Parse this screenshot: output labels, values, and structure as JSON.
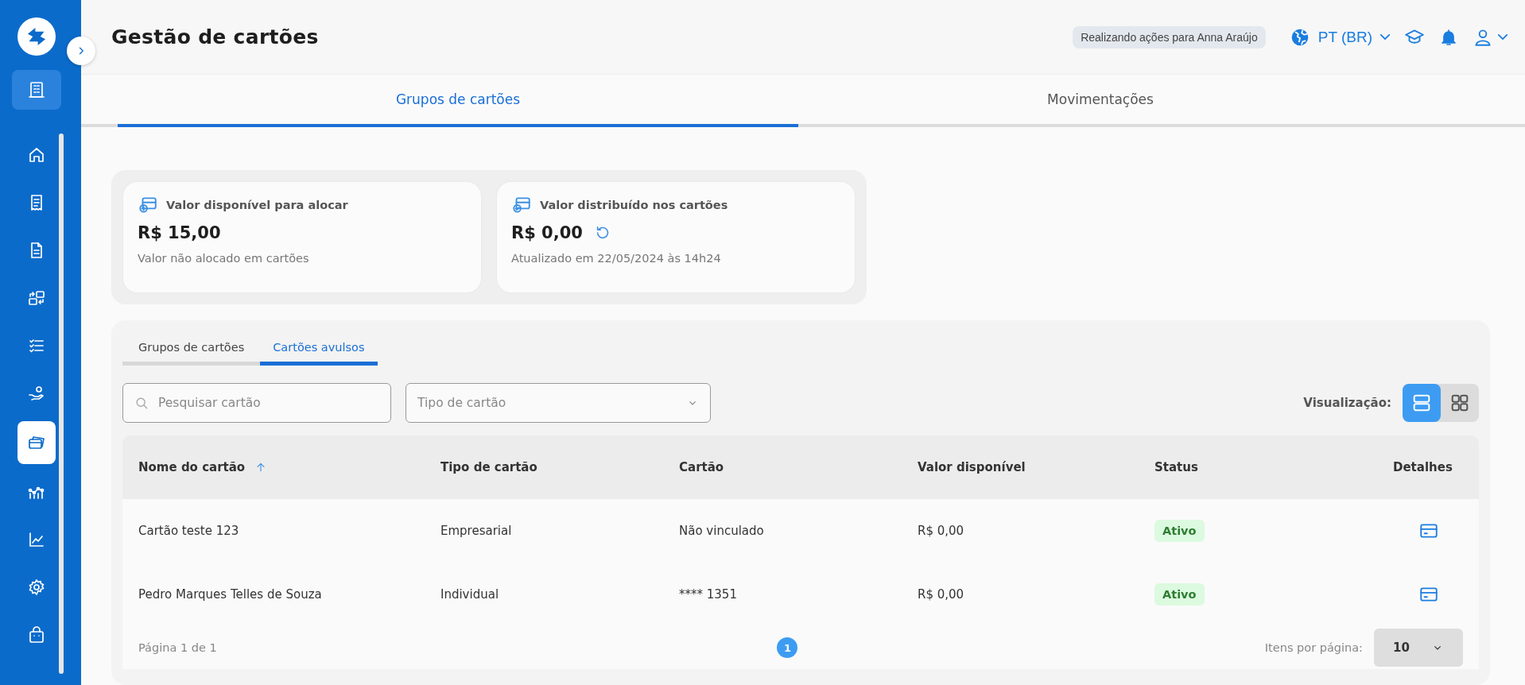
{
  "sidebar": {
    "items": [
      {
        "kind": "building",
        "selected": false
      },
      {
        "kind": "home",
        "selected": false
      },
      {
        "kind": "receipt",
        "selected": false
      },
      {
        "kind": "document",
        "selected": false
      },
      {
        "kind": "transfer",
        "selected": false
      },
      {
        "kind": "checklist",
        "selected": false
      },
      {
        "kind": "hand-coin",
        "selected": false
      },
      {
        "kind": "cards",
        "selected": true
      },
      {
        "kind": "analytics",
        "selected": false
      },
      {
        "kind": "chart",
        "selected": false
      },
      {
        "kind": "gear",
        "selected": false
      },
      {
        "kind": "bag",
        "selected": false
      }
    ]
  },
  "header": {
    "title": "Gestão de cartões",
    "acting_badge": "Realizando ações para Anna Araújo",
    "language": "PT (BR)"
  },
  "tabs": [
    {
      "label": "Grupos de cartões",
      "selected": true
    },
    {
      "label": "Movimentações",
      "selected": false
    }
  ],
  "summary_cards": [
    {
      "kind": "available",
      "title": "Valor disponível para alocar",
      "value": "R$ 15,00",
      "note": "Valor não alocado em cartões",
      "refresh": false
    },
    {
      "kind": "distributed",
      "title": "Valor distribuído nos cartões",
      "value": "R$ 0,00",
      "note": "Atualizado em 22/05/2024 às 14h24",
      "refresh": true
    }
  ],
  "sub_tabs": [
    {
      "label": "Grupos de cartões",
      "selected": false
    },
    {
      "label": "Cartões avulsos",
      "selected": true
    }
  ],
  "filters": {
    "search": {
      "placeholder": "Pesquisar cartão"
    },
    "type_select": {
      "placeholder": "Tipo de cartão"
    }
  },
  "view": {
    "label": "Visualização:",
    "options": [
      {
        "kind": "list",
        "selected": true
      },
      {
        "kind": "grid",
        "selected": false
      }
    ]
  },
  "table": {
    "columns": [
      {
        "label": "Nome do cartão",
        "sorted": true
      },
      {
        "label": "Tipo de cartão",
        "sorted": false
      },
      {
        "label": "Cartão",
        "sorted": false
      },
      {
        "label": "Valor disponível",
        "sorted": false
      },
      {
        "label": "Status",
        "sorted": false
      },
      {
        "label": "Detalhes",
        "sorted": false
      }
    ],
    "rows": [
      {
        "name": "Cartão teste 123",
        "type": "Empresarial",
        "card": "Não vinculado",
        "value": "R$ 0,00",
        "status": "Ativo"
      },
      {
        "name": "Pedro Marques Telles de Souza",
        "type": "Individual",
        "card": "**** 1351",
        "value": "R$ 0,00",
        "status": "Ativo"
      }
    ]
  },
  "pagination": {
    "summary": "Página 1 de 1",
    "pages": [
      {
        "label": "1",
        "selected": true
      }
    ],
    "per_page_label": "Itens por página:",
    "per_page": "10"
  }
}
